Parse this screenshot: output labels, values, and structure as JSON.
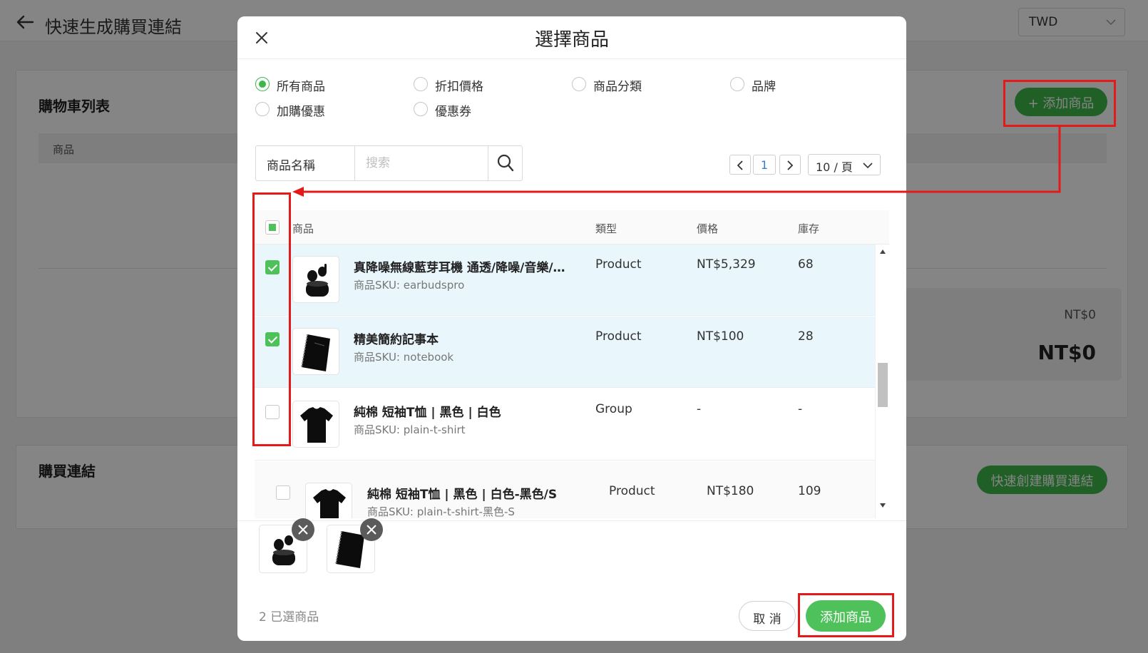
{
  "page": {
    "title": "快速生成購買連結",
    "currency": "TWD"
  },
  "cart_card": {
    "title": "購物車列表",
    "add_button": "+ 添加商品",
    "column_product": "商品",
    "subtotal": "NT$0",
    "total": "NT$0"
  },
  "links_card": {
    "title": "購買連結",
    "quick_create_button": "快速創建購買連結"
  },
  "modal": {
    "title": "選擇商品",
    "filters": [
      {
        "label": "所有商品",
        "checked": true
      },
      {
        "label": "折扣價格",
        "checked": false
      },
      {
        "label": "商品分類",
        "checked": false
      },
      {
        "label": "品牌",
        "checked": false
      },
      {
        "label": "加購優惠",
        "checked": false
      },
      {
        "label": "優惠券",
        "checked": false
      }
    ],
    "search": {
      "field": "商品名稱",
      "placeholder": "搜索"
    },
    "pager": {
      "current": "1",
      "page_size": "10 / 頁"
    },
    "columns": {
      "product": "商品",
      "type": "類型",
      "price": "價格",
      "stock": "庫存"
    },
    "rows": [
      {
        "name": "真降噪無線藍芽耳機 通透/降噪/音樂/…",
        "sku": "商品SKU: earbudspro",
        "type": "Product",
        "price": "NT$5,329",
        "stock": "68",
        "checked": true
      },
      {
        "name": "精美簡約記事本",
        "sku": "商品SKU: notebook",
        "type": "Product",
        "price": "NT$100",
        "stock": "28",
        "checked": true
      },
      {
        "name": "純棉 短袖T恤 | 黑色 | 白色",
        "sku": "商品SKU: plain-t-shirt",
        "type": "Group",
        "price": "-",
        "stock": "-",
        "checked": false
      },
      {
        "name": "純棉 短袖T恤 | 黑色 | 白色-黑色/S",
        "sku": "商品SKU: plain-t-shirt-黑色-S",
        "type": "Product",
        "price": "NT$180",
        "stock": "109",
        "checked": false
      }
    ],
    "selected_count": "2 已選商品",
    "cancel_button": "取 消",
    "confirm_button": "添加商品"
  },
  "colors": {
    "brand_green": "#4fc15a",
    "selected_row": "#e9f6fc",
    "annotation_red": "#e41a1a"
  }
}
